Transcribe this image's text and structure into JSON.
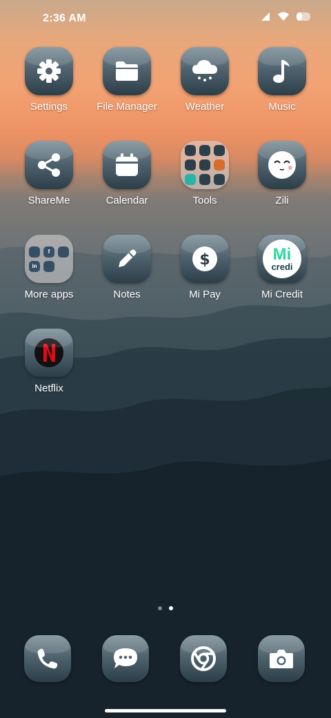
{
  "status": {
    "time": "2:36 AM"
  },
  "apps": [
    {
      "label": "Settings",
      "icon": "gear-icon"
    },
    {
      "label": "File Manager",
      "icon": "folder-icon"
    },
    {
      "label": "Weather",
      "icon": "cloud-snow-icon"
    },
    {
      "label": "Music",
      "icon": "music-note-icon"
    },
    {
      "label": "ShareMe",
      "icon": "share-icon"
    },
    {
      "label": "Calendar",
      "icon": "calendar-icon"
    },
    {
      "label": "Tools",
      "icon": "folder-tools"
    },
    {
      "label": "Zili",
      "icon": "smiley-face-icon"
    },
    {
      "label": "More apps",
      "icon": "folder-more-apps"
    },
    {
      "label": "Notes",
      "icon": "pencil-icon"
    },
    {
      "label": "Mi Pay",
      "icon": "dollar-icon"
    },
    {
      "label": "Mi Credit",
      "icon": "mi-credit-icon"
    },
    {
      "label": "Netflix",
      "icon": "netflix-icon"
    }
  ],
  "folder_more_apps": {
    "mini": [
      "",
      "f",
      "",
      "in",
      ""
    ]
  },
  "mi_credit": {
    "logo_text": "Mi",
    "logo_sub": "credi"
  },
  "dock": [
    {
      "name": "phone",
      "icon": "phone-icon"
    },
    {
      "name": "messaging",
      "icon": "chat-bubble-icon"
    },
    {
      "name": "chrome",
      "icon": "chrome-icon"
    },
    {
      "name": "camera",
      "icon": "camera-icon"
    }
  ],
  "page_indicator": {
    "pages": 2,
    "current": 2
  },
  "colors": {
    "netflix_red": "#e50914",
    "mi_credit_green": "#1fd79b",
    "folder_tile": "#355066"
  }
}
